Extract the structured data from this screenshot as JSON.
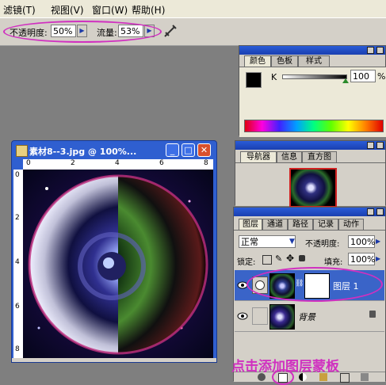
{
  "menu": {
    "items": [
      "滤镜(T)",
      "视图(V)",
      "窗口(W)",
      "帮助(H)"
    ]
  },
  "options": {
    "opacity_label": "不透明度:",
    "opacity_value": "50%",
    "flow_label": "流量:",
    "flow_value": "53%"
  },
  "color_palette": {
    "tabs": [
      "颜色",
      "色板",
      "样式"
    ],
    "channel_label": "K",
    "channel_value": "100",
    "channel_unit": "%"
  },
  "navigator_palette": {
    "tabs": [
      "导航器",
      "信息",
      "直方图"
    ]
  },
  "document": {
    "title": "素材8--3.jpg @ 100%...",
    "ruler_top": [
      "0",
      "2",
      "4",
      "6",
      "8"
    ],
    "ruler_left": [
      "0",
      "2",
      "4",
      "6",
      "8"
    ]
  },
  "layers_palette": {
    "tabs": [
      "图层",
      "通道",
      "路径",
      "记录",
      "动作"
    ],
    "blend_mode": "正常",
    "opacity_label": "不透明度:",
    "opacity_value": "100%",
    "lock_label": "锁定:",
    "fill_label": "填充:",
    "fill_value": "100%",
    "layers": [
      {
        "name": "图层 1"
      },
      {
        "name": "背景"
      }
    ]
  },
  "annotation": {
    "caption": "点击添加图层蒙板"
  },
  "colors": {
    "titlebar": "#2f5fd0",
    "annotation": "#d030c0",
    "selected_layer": "#3a64c8"
  }
}
